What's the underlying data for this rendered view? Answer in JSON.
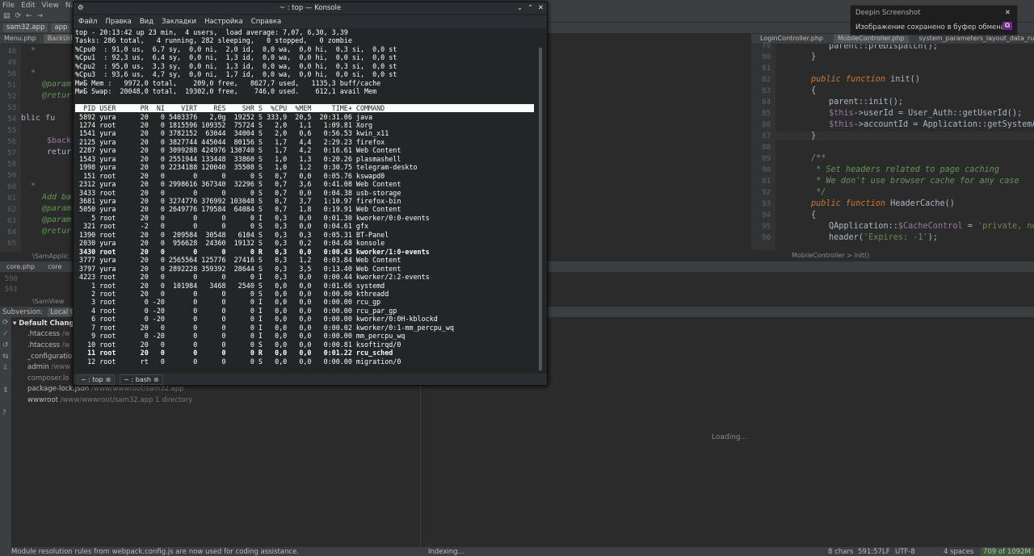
{
  "ide": {
    "menu": [
      "File",
      "Edit",
      "View",
      "Navig"
    ],
    "breadcrumb": [
      "sam32.app",
      "app",
      "m"
    ],
    "left_tabs": [
      "Menu.php",
      "BackUrl"
    ],
    "right_tabs": [
      "LoginController.php",
      "MobileController.php",
      "system_parameters_layout_data_ru.p"
    ],
    "left_lines": [
      "48",
      "49",
      "50",
      "51",
      "52",
      "53",
      "54",
      "55",
      "56",
      "57",
      "58",
      "59",
      "60",
      "61",
      "62",
      "63",
      "64",
      "65"
    ],
    "left_code": [
      "*",
      "",
      "*",
      "@param",
      "@retur",
      "",
      "blic fu",
      "",
      "$back",
      "retur",
      "",
      "",
      "*",
      "Add ba",
      "@param",
      "@param",
      "@retur",
      ""
    ],
    "right_lines": [
      "79",
      "80",
      "81",
      "82",
      "83",
      "84",
      "85",
      "86",
      "87",
      "88",
      "89",
      "90",
      "91",
      "92",
      "93",
      "94",
      "95",
      "96"
    ],
    "notification": {
      "title": "Deepin Screenshot",
      "message": "Изображение сохранено в буфер обмена"
    },
    "mid_tabs": [
      "core.php",
      "core"
    ],
    "mid_breadcrumb_left": "\\SamApplic",
    "mid_breadcrumb_right": "MobileController  > init()",
    "lower_lines": [
      "590",
      "591"
    ],
    "vcs": {
      "label": "Subversion:",
      "tab": "Local Cha",
      "default_changelist": "Default Changel",
      "items": [
        {
          "name": ".htaccess",
          "path": "/w"
        },
        {
          "name": ".htaccess",
          "path": "/w"
        },
        {
          "name": "_configuratio",
          "path": ""
        },
        {
          "name": "admin",
          "path": "/www"
        },
        {
          "name": "composer.lo",
          "path": ""
        },
        {
          "name": "package-lock.json",
          "path": "/www/wwwroot/sam32.app"
        },
        {
          "name": "wwwroot",
          "path": "/www/wwwroot/sam32.app  1 directory"
        }
      ],
      "samview": "\\SamView"
    },
    "loading": "Loading...",
    "status_left": "Module resolution rules from webpack.config.js are now used for coding assistance.",
    "status_indexing": "Indexing...",
    "status_right": [
      "8 chars",
      "591:57",
      "LF",
      "UTF-8",
      "4 spaces",
      "709 of 1092M"
    ]
  },
  "konsole": {
    "title": "~ : top — Konsole",
    "menu": [
      "Файл",
      "Правка",
      "Вид",
      "Закладки",
      "Настройка",
      "Справка"
    ],
    "tabs": [
      "~ : top",
      "~ : bash"
    ],
    "summary": [
      "top - 20:13:42 up 23 min,  4 users,  load average: 7,07, 6,30, 3,39",
      "Tasks: 286 total,   4 running, 282 sleeping,   0 stopped,   0 zombie",
      "%Cpu0  : 91,0 us,  6,7 sy,  0,0 ni,  2,0 id,  0,0 wa,  0,0 hi,  0,3 si,  0,0 st",
      "%Cpu1  : 92,3 us,  6,4 sy,  0,0 ni,  1,3 id,  0,0 wa,  0,0 hi,  0,0 si,  0,0 st",
      "%Cpu2  : 95,0 us,  3,3 sy,  0,0 ni,  1,3 id,  0,0 wa,  0,0 hi,  0,3 si,  0,0 st",
      "%Cpu3  : 93,6 us,  4,7 sy,  0,0 ni,  1,7 id,  0,0 wa,  0,0 hi,  0,0 si,  0,0 st",
      "МиБ Mem :   9972,0 total,    209,0 free,   8627,7 used,   1135,3 buff/cache",
      "МиБ Swap:  20048,0 total,  19302,0 free,    746,0 used.    612,1 avail Mem"
    ],
    "header": "  PID USER      PR  NI    VIRT    RES    SHR S  %CPU  %MEM     TIME+ COMMAND",
    "processes": [
      {
        "line": " 5892 yura      20   0 5403376   2,0g  19252 S 333,9  20,5  20:31.06 java",
        "bold": false
      },
      {
        "line": " 1274 root      20   0 1815596 109352  75724 S   2,0   1,1   1:09.81 Xorg",
        "bold": false
      },
      {
        "line": " 1541 yura      20   0 3782152  63044  34004 S   2,0   0,6   0:56.53 kwin_x11",
        "bold": false
      },
      {
        "line": " 2125 yura      20   0 3827744 445044  80156 S   1,7   4,4   2:29.23 firefox",
        "bold": false
      },
      {
        "line": " 2287 yura      20   0 3099288 424976 130740 S   1,7   4,2   0:16.61 Web Content",
        "bold": false
      },
      {
        "line": " 1543 yura      20   0 2551944 133448  33860 S   1,0   1,3   0:20.26 plasmashell",
        "bold": false
      },
      {
        "line": " 1998 yura      20   0 2234188 120040  35508 S   1,0   1,2   0:30.75 telegram-deskto",
        "bold": false
      },
      {
        "line": "  151 root      20   0       0      0      0 S   0,7   0,0   0:05.76 kswapd0",
        "bold": false
      },
      {
        "line": " 2312 yura      20   0 2998616 367340  32296 S   0,7   3,6   0:41.08 Web Content",
        "bold": false
      },
      {
        "line": " 3433 root      20   0       0      0      0 S   0,7   0,0   0:04.38 usb-storage",
        "bold": false
      },
      {
        "line": " 3681 yura      20   0 3274776 376992 103048 S   0,7   3,7   1:10.97 firefox-bin",
        "bold": false
      },
      {
        "line": " 5050 yura      20   0 2649776 179584  64084 S   0,7   1,8   0:19.91 Web Content",
        "bold": false
      },
      {
        "line": "    5 root      20   0       0      0      0 I   0,3   0,0   0:01.30 kworker/0:0-events",
        "bold": false
      },
      {
        "line": "  321 root      -2   0       0      0      0 S   0,3   0,0   0:04.61 gfx",
        "bold": false
      },
      {
        "line": " 1390 root      20   0  209584  30548   6104 S   0,3   0,3   0:05.31 BT-Panel",
        "bold": false
      },
      {
        "line": " 2030 yura      20   0  956628  24360  19132 S   0,3   0,2   0:04.68 konsole",
        "bold": false
      },
      {
        "line": " 3430 root      20   0       0      0      0 R   0,3   0,0   0:00.43 kworker/1:0-events",
        "bold": true
      },
      {
        "line": " 3777 yura      20   0 2565564 125776  27416 S   0,3   1,2   0:03.84 Web Content",
        "bold": false
      },
      {
        "line": " 3797 yura      20   0 2892228 359392  28644 S   0,3   3,5   0:13.40 Web Content",
        "bold": false
      },
      {
        "line": " 4223 root      20   0       0      0      0 I   0,3   0,0   0:00.44 kworker/2:2-events",
        "bold": false
      },
      {
        "line": "    1 root      20   0  101984   3468   2540 S   0,0   0,0   0:01.66 systemd",
        "bold": false
      },
      {
        "line": "    2 root      20   0       0      0      0 S   0,0   0,0   0:00.00 kthreadd",
        "bold": false
      },
      {
        "line": "    3 root       0 -20       0      0      0 I   0,0   0,0   0:00.00 rcu_gp",
        "bold": false
      },
      {
        "line": "    4 root       0 -20       0      0      0 I   0,0   0,0   0:00.00 rcu_par_gp",
        "bold": false
      },
      {
        "line": "    6 root       0 -20       0      0      0 I   0,0   0,0   0:00.00 kworker/0:0H-kblockd",
        "bold": false
      },
      {
        "line": "    7 root      20   0       0      0      0 I   0,0   0,0   0:00.02 kworker/0:1-mm_percpu_wq",
        "bold": false
      },
      {
        "line": "    9 root       0 -20       0      0      0 I   0,0   0,0   0:00.00 mm_percpu_wq",
        "bold": false
      },
      {
        "line": "   10 root      20   0       0      0      0 S   0,0   0,0   0:00.81 ksoftirqd/0",
        "bold": false
      },
      {
        "line": "   11 root      20   0       0      0      0 R   0,0   0,0   0:01.22 rcu_sched",
        "bold": true
      },
      {
        "line": "   12 root      rt   0       0      0      0 S   0,0   0,0   0:00.00 migration/0",
        "bold": false
      }
    ]
  }
}
